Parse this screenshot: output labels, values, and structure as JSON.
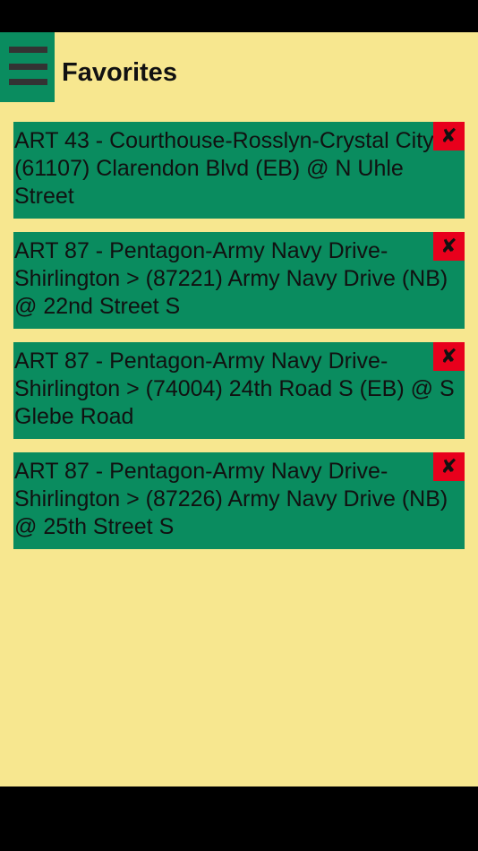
{
  "header": {
    "title": "Favorites",
    "menu_icon": "hamburger-menu-icon"
  },
  "favorites": [
    {
      "text": "ART 43 - Courthouse-Rosslyn-Crystal City > (61107) Clarendon Blvd (EB) @ N Uhle Street",
      "delete_glyph": "✘"
    },
    {
      "text": "ART 87 - Pentagon-Army Navy Drive-Shirlington > (87221) Army Navy Drive (NB) @ 22nd Street S",
      "delete_glyph": "✘"
    },
    {
      "text": "ART 87 - Pentagon-Army Navy Drive-Shirlington > (74004) 24th Road S (EB) @ S Glebe Road",
      "delete_glyph": "✘"
    },
    {
      "text": "ART 87 - Pentagon-Army Navy Drive-Shirlington > (87226) Army Navy Drive (NB) @ 25th Street S",
      "delete_glyph": "✘"
    }
  ],
  "colors": {
    "background": "#f7e78f",
    "item_background": "#0a8c5f",
    "delete_background": "#e8001c",
    "text": "#111111"
  }
}
